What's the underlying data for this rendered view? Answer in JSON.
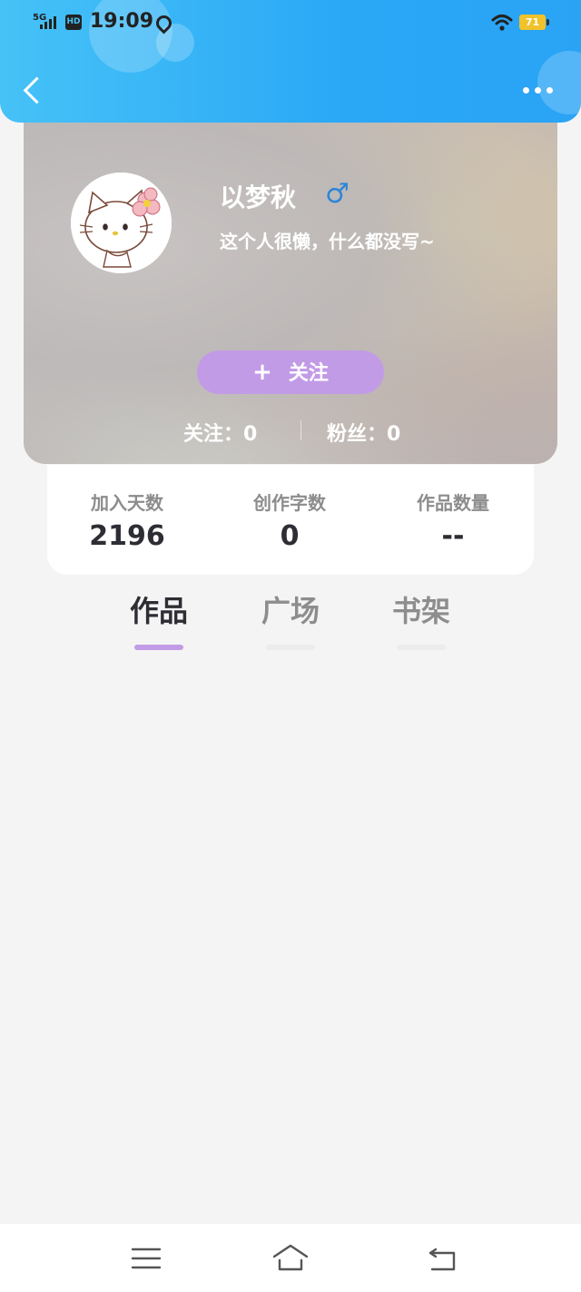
{
  "status_bar": {
    "network": "5G",
    "hd_badge": "HD",
    "time": "19:09",
    "battery": "71"
  },
  "profile": {
    "username": "以梦秋",
    "gender_symbol": "♂",
    "bio": "这个人很懒，什么都没写~",
    "follow_button_plus": "+",
    "follow_button_label": "关注",
    "following_text": "关注：0",
    "fans_text": "粉丝：0"
  },
  "stats": [
    {
      "label": "加入天数",
      "value": "2196"
    },
    {
      "label": "创作字数",
      "value": "0"
    },
    {
      "label": "作品数量",
      "value": "--"
    }
  ],
  "tabs": [
    {
      "label": "作品",
      "active": true
    },
    {
      "label": "广场",
      "active": false
    },
    {
      "label": "书架",
      "active": false
    }
  ],
  "colors": {
    "header": "#2aa8f6",
    "accent_purple": "#c29be6",
    "gender_blue": "#2e86d8"
  },
  "icons": {
    "back": "chevron-left-icon",
    "more": "more-dots-icon",
    "nav_menu": "menu-icon",
    "nav_home": "home-icon",
    "nav_back": "back-icon"
  }
}
